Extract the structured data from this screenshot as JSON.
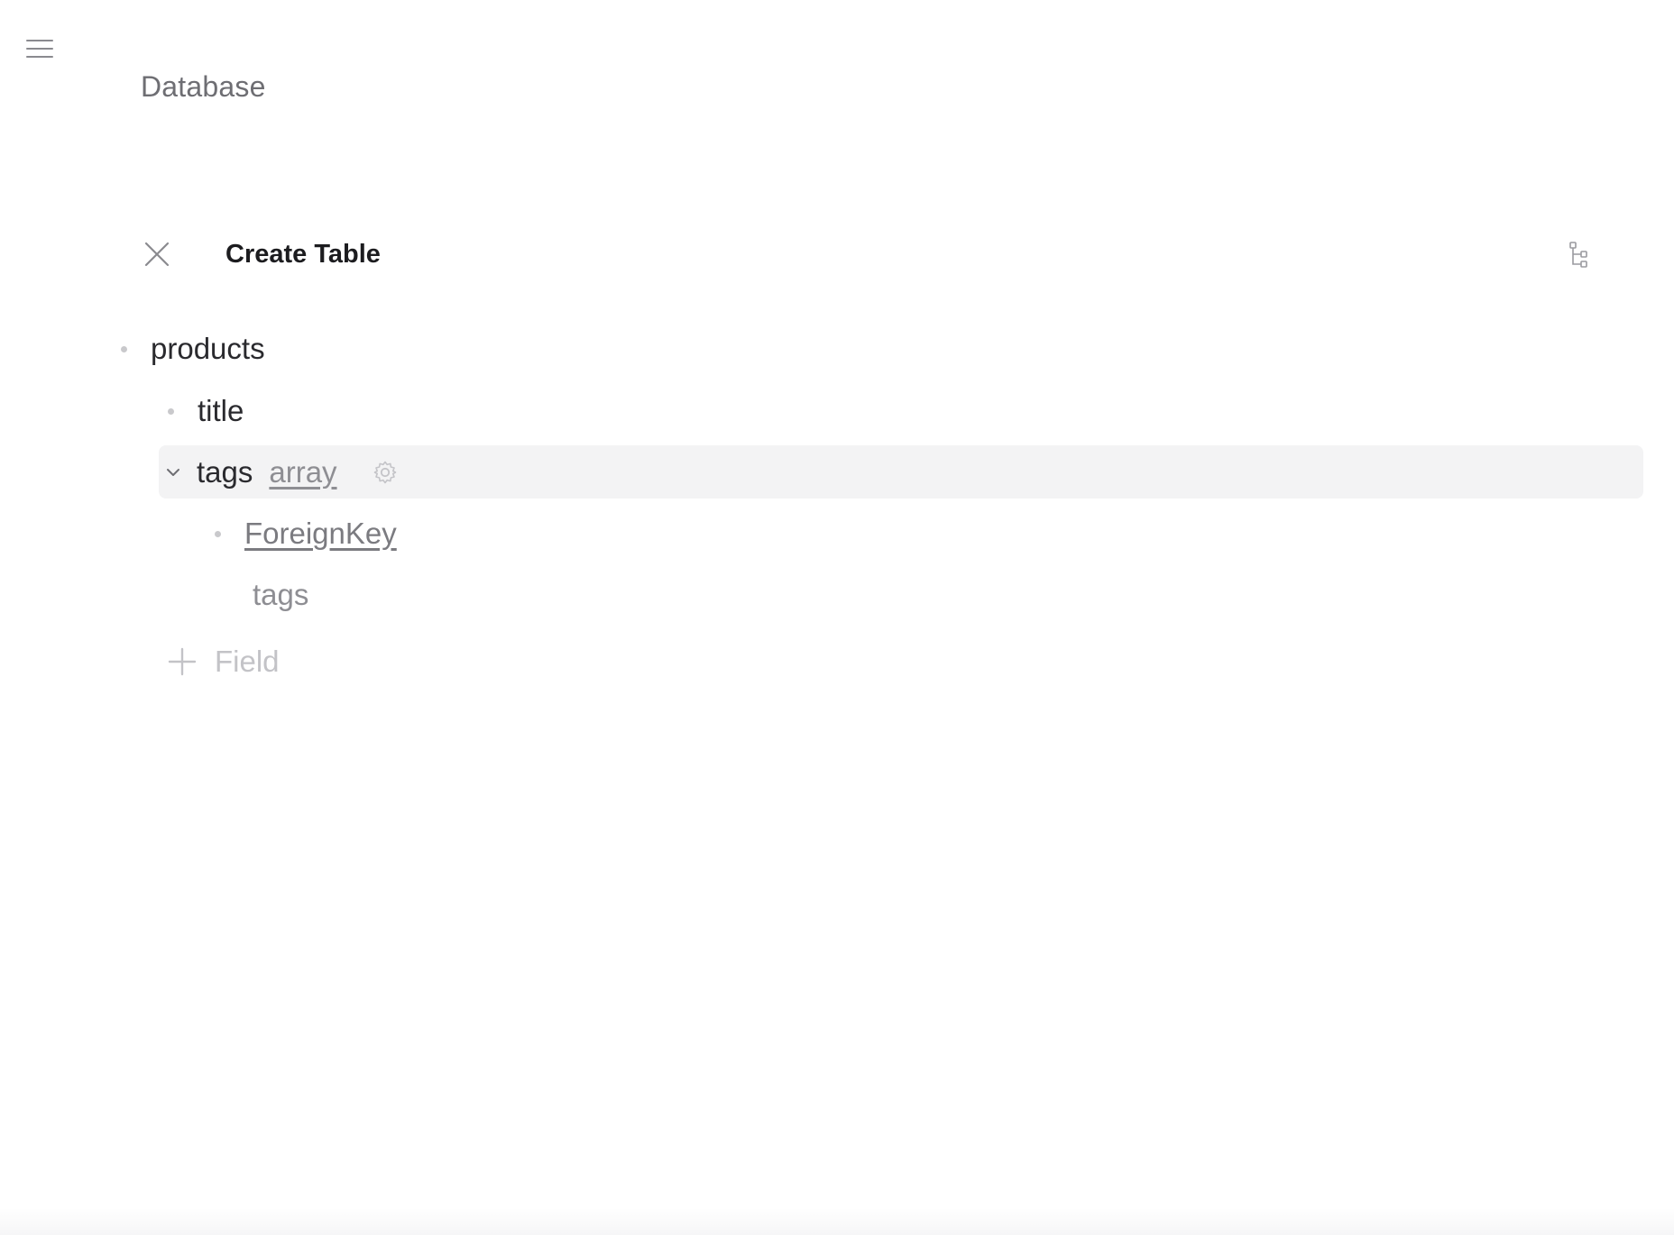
{
  "breadcrumb": {
    "label": "Database"
  },
  "header": {
    "title": "Create Table"
  },
  "tree": {
    "root": {
      "label": "products"
    },
    "fields": [
      {
        "label": "title"
      },
      {
        "label": "tags",
        "type": "array",
        "expanded": true,
        "children": [
          {
            "label": "ForeignKey",
            "ref": "tags"
          }
        ]
      }
    ],
    "add_field_label": "Field"
  },
  "icons": {
    "menu": "hamburger-icon",
    "close": "close-icon",
    "tree_view": "tree-structure-icon",
    "chevron": "chevron-down-icon",
    "settings": "gear-icon",
    "add": "plus-icon"
  },
  "colors": {
    "selected_row_bg": "#f3f3f4",
    "muted_text": "#8e8e93",
    "bullet": "#c9c9cc"
  }
}
